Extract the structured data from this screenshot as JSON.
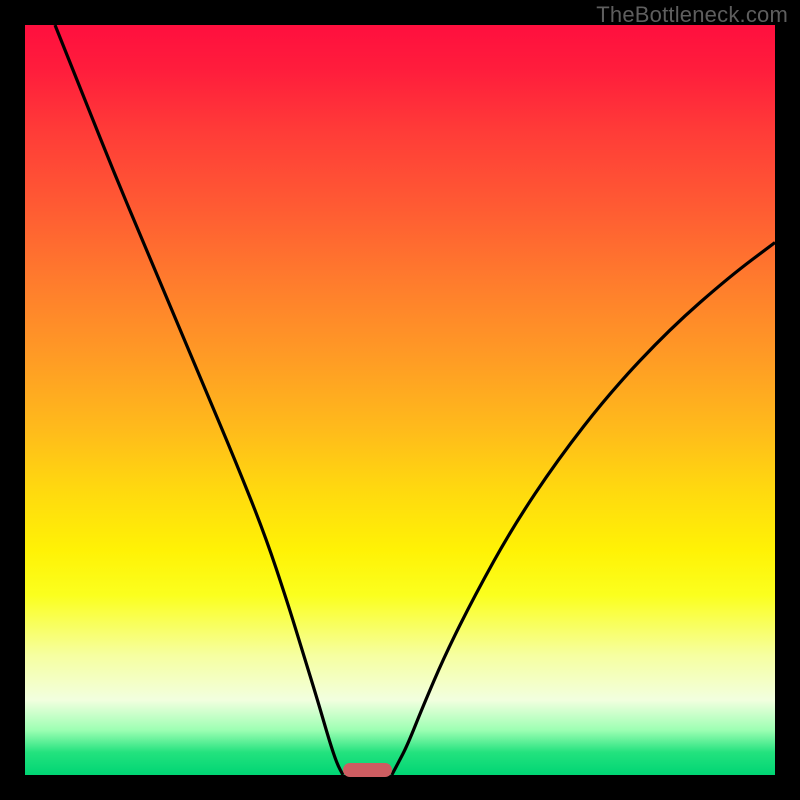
{
  "watermark": "TheBottleneck.com",
  "colors": {
    "curve": "#000000",
    "marker": "#cd5d61",
    "frame_bg_top": "#ff0f3e",
    "frame_bg_bottom": "#00d574"
  },
  "chart_data": {
    "type": "line",
    "title": "",
    "xlabel": "",
    "ylabel": "",
    "xlim": [
      0,
      100
    ],
    "ylim": [
      0,
      100
    ],
    "grid": false,
    "note": "Values are read off the plot by estimating pixel positions against the frame; x and y are normalized 0–100. The two curves form a V meeting near the bottom.",
    "series": [
      {
        "name": "left-curve",
        "x": [
          4.0,
          8.0,
          12.0,
          16.0,
          20.0,
          24.0,
          28.0,
          32.0,
          35.0,
          37.0,
          39.0,
          40.6,
          41.6,
          42.4
        ],
        "y": [
          100.0,
          90.0,
          80.0,
          70.5,
          61.0,
          51.5,
          42.0,
          32.0,
          23.0,
          16.5,
          10.0,
          4.5,
          1.5,
          0.0
        ]
      },
      {
        "name": "right-curve",
        "x": [
          48.9,
          49.7,
          51.0,
          53.0,
          56.0,
          60.0,
          65.0,
          71.0,
          78.0,
          86.0,
          94.0,
          100.0
        ],
        "y": [
          0.0,
          1.5,
          4.0,
          9.0,
          16.0,
          24.0,
          33.0,
          42.0,
          51.0,
          59.5,
          66.5,
          71.0
        ]
      }
    ],
    "marker": {
      "x_start": 42.4,
      "x_end": 48.9,
      "y": 0.0,
      "description": "flat rounded bar on the baseline bridging the two curve feet"
    }
  }
}
